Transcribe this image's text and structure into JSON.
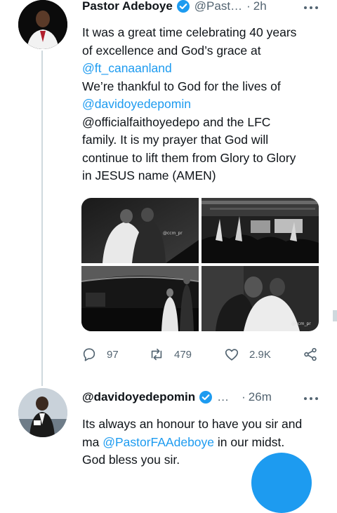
{
  "tweet1": {
    "display_name": "Pastor Adeboye",
    "handle": "@Past…",
    "time": "2h",
    "lines": [
      "It was a great time celebrating 40 years",
      "of excellence and God’s grace at",
      "@ft_canaanland",
      "We’re thankful to God for the lives of",
      "@davidoyedepomin",
      "@officialfaithoyedepo and the LFC",
      "family. It is my prayer that God will",
      "continue to lift them from Glory to Glory",
      "in JESUS name (AMEN)"
    ],
    "replies": "97",
    "retweets": "479",
    "likes": "2.9K",
    "photo_watermark_top": "@ccm_pr",
    "photo_watermark_bottom": "@ccm_pr"
  },
  "tweet2": {
    "display_name": "@davidoyedepomin",
    "handle": "…",
    "time": "26m",
    "line1": "Its always an honour to have you sir and",
    "line2_prefix": "ma ",
    "line2_mention": "@PastorFAAdeboye",
    "line2_suffix": " in our midst.",
    "line3": "God bless you sir."
  },
  "icons": {
    "verified": "verified-badge-icon",
    "more": "more-horizontal-icon",
    "reply": "reply-icon",
    "retweet": "retweet-icon",
    "like": "heart-icon",
    "share": "share-icon"
  },
  "colors": {
    "link": "#1d9bf0",
    "text": "#0f1419",
    "muted": "#536471",
    "thread_line": "#cfd9de"
  }
}
